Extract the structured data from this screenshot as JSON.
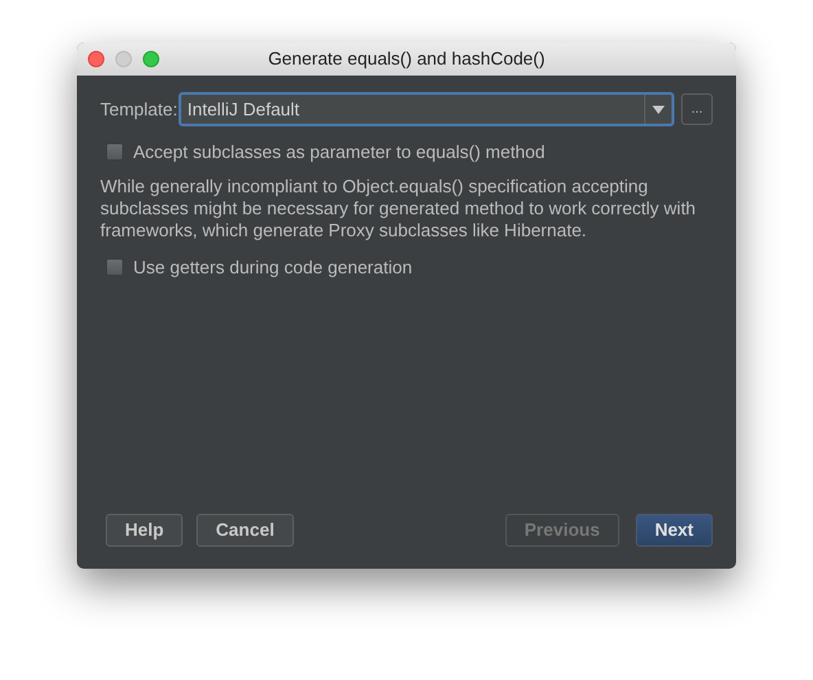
{
  "window": {
    "title": "Generate equals() and hashCode()"
  },
  "template": {
    "label": "Template:",
    "value": "IntelliJ Default",
    "more": "..."
  },
  "options": [
    {
      "label": "Accept subclasses as parameter to equals() method",
      "checked": false,
      "note": "While generally incompliant to Object.equals() specification accepting subclasses might be necessary for generated method to work correctly with frameworks, which generate Proxy subclasses like Hibernate."
    },
    {
      "label": "Use getters during code generation",
      "checked": false
    }
  ],
  "buttons_left": [
    {
      "label": "Help",
      "disabled": false,
      "default": false
    },
    {
      "label": "Cancel",
      "disabled": false,
      "default": false
    }
  ],
  "buttons_right": [
    {
      "label": "Previous",
      "disabled": true,
      "default": false
    },
    {
      "label": "Next",
      "disabled": false,
      "default": true
    }
  ]
}
